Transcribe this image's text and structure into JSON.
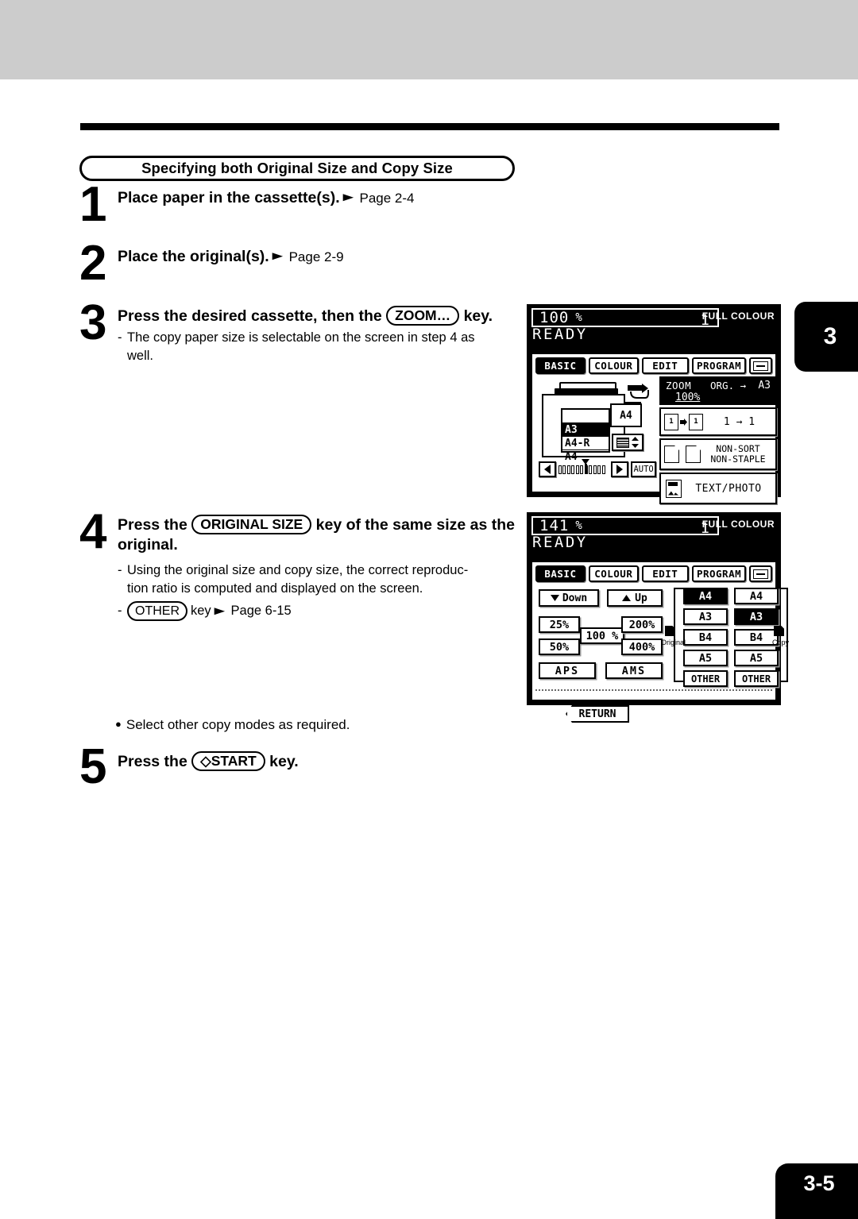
{
  "page": {
    "number": "3-5",
    "side_tab": "3"
  },
  "section": {
    "heading": "Specifying both Original Size and Copy Size"
  },
  "steps": [
    {
      "num": "1",
      "title": "Place paper in the cassette(s).",
      "ref": "Page 2-4"
    },
    {
      "num": "2",
      "title": "Place the original(s).",
      "ref": "Page 2-9"
    },
    {
      "num": "3",
      "title_before": "Press the desired cassette, then the",
      "key": "ZOOM…",
      "title_after": "key.",
      "note_line1": "The copy paper size is selectable on the screen in step 4 as",
      "note_line2": "well."
    },
    {
      "num": "4",
      "title_before": "Press the",
      "key": "ORIGINAL SIZE",
      "title_after": "key of the same size as the original.",
      "note_line1": "Using the original size and copy size, the correct reproduc-",
      "note_line2": "tion ratio is computed and displayed on the screen.",
      "note2_key": "OTHER",
      "note2_word": "key",
      "note2_ref": "Page 6-15"
    },
    {
      "num": "5",
      "title_before": "Press the",
      "key": "START",
      "key_glyph": "◇",
      "title_after": "key."
    }
  ],
  "bullet_note": "Select other copy modes as required.",
  "lcd1": {
    "ratio": "100",
    "percent": "%",
    "copies": "1",
    "colour_mode": "FULL COLOUR",
    "status": "READY",
    "tabs": [
      {
        "label": "BASIC",
        "selected": true
      },
      {
        "label": "COLOUR",
        "selected": false
      },
      {
        "label": "EDIT",
        "selected": false
      },
      {
        "label": "PROGRAM",
        "selected": false
      }
    ],
    "cassettes": [
      {
        "label": "",
        "selected": false
      },
      {
        "label": "A3",
        "selected": true
      },
      {
        "label": "A4-R",
        "selected": false
      },
      {
        "label": "A4",
        "selected": false
      }
    ],
    "bypass_size": "A4",
    "auto_label": "AUTO",
    "zoom_button": {
      "label": "ZOOM",
      "org_label": "ORG.",
      "arrow": "→",
      "dest": "A3",
      "value": "100%"
    },
    "duplex_button": {
      "label": "1 → 1"
    },
    "finish_button": {
      "line1": "NON-SORT",
      "line2": "NON-STAPLE"
    },
    "mode_button": {
      "label": "TEXT/PHOTO"
    }
  },
  "lcd2": {
    "ratio": "141",
    "percent": "%",
    "copies": "1",
    "colour_mode": "FULL COLOUR",
    "status": "READY",
    "tabs": [
      {
        "label": "BASIC",
        "selected": true
      },
      {
        "label": "COLOUR",
        "selected": false
      },
      {
        "label": "EDIT",
        "selected": false
      },
      {
        "label": "PROGRAM",
        "selected": false
      }
    ],
    "down_button": "Down",
    "up_button": "Up",
    "preset_25": "25%",
    "preset_50": "50%",
    "preset_100": "100 %",
    "preset_200": "200%",
    "preset_400": "400%",
    "aps_button": "APS",
    "ams_button": "AMS",
    "return_button": "RETURN",
    "original_label": "Original",
    "copy_label": "Copy",
    "original_sizes": [
      {
        "label": "A4",
        "selected": true
      },
      {
        "label": "A3",
        "selected": false
      },
      {
        "label": "B4",
        "selected": false
      },
      {
        "label": "A5",
        "selected": false
      },
      {
        "label": "OTHER",
        "selected": false
      }
    ],
    "copy_sizes": [
      {
        "label": "A4",
        "selected": false
      },
      {
        "label": "A3",
        "selected": true
      },
      {
        "label": "B4",
        "selected": false
      },
      {
        "label": "A5",
        "selected": false
      },
      {
        "label": "OTHER",
        "selected": false
      }
    ]
  }
}
